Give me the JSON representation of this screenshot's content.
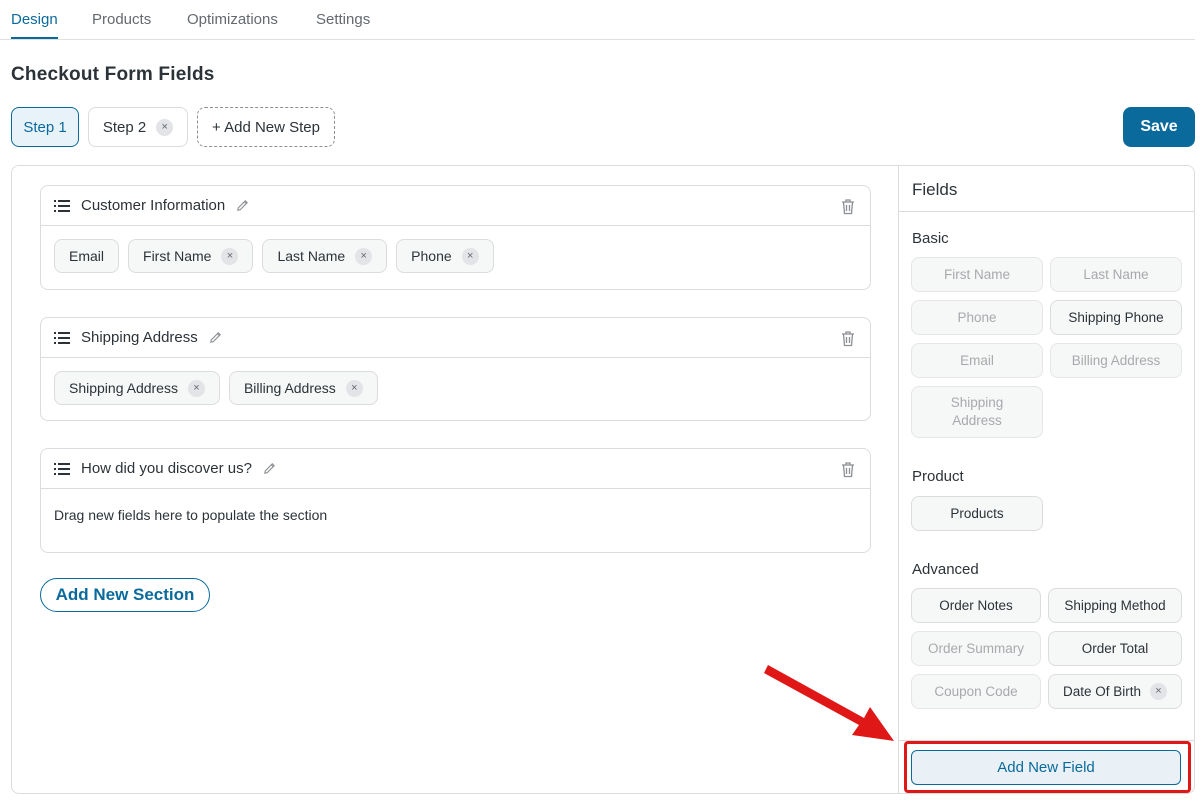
{
  "tabs": [
    "Design",
    "Products",
    "Optimizations",
    "Settings"
  ],
  "page_title": "Checkout Form Fields",
  "steps": {
    "step1": "Step 1",
    "step2": "Step 2",
    "add_step": "+ Add New Step",
    "remove_glyph": "×"
  },
  "save_label": "Save",
  "sections": [
    {
      "title": "Customer Information",
      "chips": [
        {
          "label": "Email",
          "removable": false
        },
        {
          "label": "First Name",
          "removable": true
        },
        {
          "label": "Last Name",
          "removable": true
        },
        {
          "label": "Phone",
          "removable": true
        }
      ]
    },
    {
      "title": "Shipping Address",
      "chips": [
        {
          "label": "Shipping Address",
          "removable": true
        },
        {
          "label": "Billing Address",
          "removable": true
        }
      ]
    },
    {
      "title": "How did you discover us?",
      "empty_text": "Drag new fields here to populate the section"
    }
  ],
  "add_section_label": "Add New Section",
  "fields_panel": {
    "title": "Fields",
    "groups": {
      "basic": {
        "label": "Basic",
        "items": [
          {
            "label": "First Name",
            "state": "disabled"
          },
          {
            "label": "Last Name",
            "state": "disabled"
          },
          {
            "label": "Phone",
            "state": "disabled"
          },
          {
            "label": "Shipping Phone",
            "state": "enabled"
          },
          {
            "label": "Email",
            "state": "disabled"
          },
          {
            "label": "Billing Address",
            "state": "disabled"
          },
          {
            "label": "Shipping Address",
            "state": "disabled"
          }
        ]
      },
      "product": {
        "label": "Product",
        "items": [
          {
            "label": "Products",
            "state": "enabled"
          }
        ]
      },
      "advanced": {
        "label": "Advanced",
        "items": [
          {
            "label": "Order Notes",
            "state": "enabled"
          },
          {
            "label": "Shipping Method",
            "state": "enabled"
          },
          {
            "label": "Order Summary",
            "state": "disabled"
          },
          {
            "label": "Order Total",
            "state": "enabled"
          },
          {
            "label": "Coupon Code",
            "state": "disabled"
          },
          {
            "label": "Date Of Birth",
            "state": "enabled"
          }
        ]
      }
    },
    "add_field_label": "Add New Field"
  },
  "colors": {
    "accent": "#0b6a9c",
    "highlight": "#e01717"
  },
  "icons": [
    "list-icon",
    "pencil-icon",
    "trash-icon",
    "close-icon",
    "arrow-annotation"
  ]
}
